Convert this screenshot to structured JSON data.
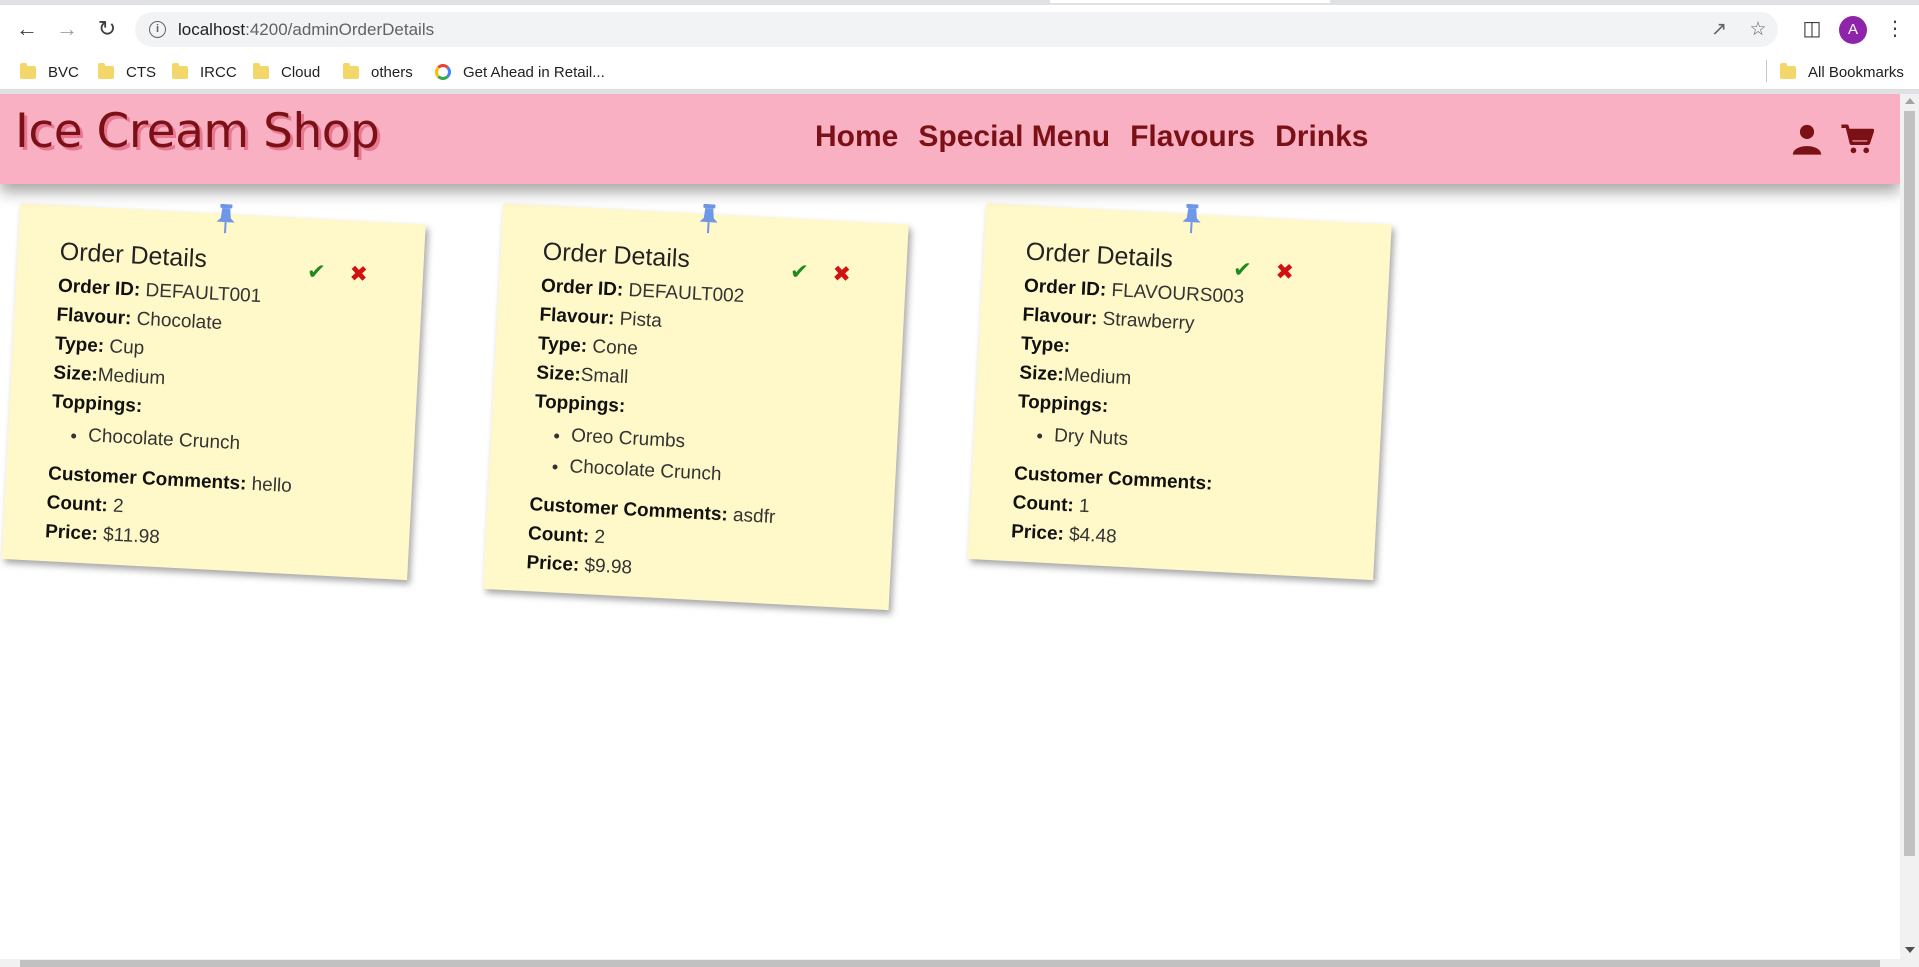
{
  "browser": {
    "url_host": "localhost",
    "url_path": ":4200/adminOrderDetails",
    "profile_initial": "A",
    "bookmarks": [
      {
        "label": "BVC",
        "icon": "folder-icon"
      },
      {
        "label": "CTS",
        "icon": "folder-icon"
      },
      {
        "label": "IRCC",
        "icon": "folder-icon"
      },
      {
        "label": "Cloud",
        "icon": "folder-icon"
      },
      {
        "label": "others",
        "icon": "folder-icon"
      },
      {
        "label": "Get Ahead in Retail...",
        "icon": "site-icon"
      }
    ],
    "all_bookmarks_label": "All Bookmarks"
  },
  "header": {
    "brand": "Ice Cream Shop",
    "nav": [
      "Home",
      "Special Menu",
      "Flavours",
      "Drinks"
    ],
    "icons": [
      "user-icon",
      "cart-icon"
    ],
    "colors": {
      "bg": "#f9b0c3",
      "text": "#7b1116"
    }
  },
  "labels": {
    "card_title": "Order Details",
    "order_id": "Order ID:",
    "flavour": "Flavour:",
    "type": "Type:",
    "size": "Size:",
    "toppings": "Toppings:",
    "comments": "Customer Comments:",
    "count": "Count:",
    "price": "Price:"
  },
  "orders": [
    {
      "order_id": "DEFAULT001",
      "flavour": "Chocolate",
      "type": "Cup",
      "size": "Medium",
      "toppings": [
        "Chocolate Crunch"
      ],
      "comments": "hello",
      "count": "2",
      "price": "$11.98"
    },
    {
      "order_id": "DEFAULT002",
      "flavour": "Pista",
      "type": "Cone",
      "size": "Small",
      "toppings": [
        "Oreo Crumbs",
        "Chocolate Crunch"
      ],
      "comments": "asdfr",
      "count": "2",
      "price": "$9.98"
    },
    {
      "order_id": "FLAVOURS003",
      "flavour": "Strawberry",
      "type": "",
      "size": "Medium",
      "toppings": [
        "Dry Nuts"
      ],
      "comments": "",
      "count": "1",
      "price": "$4.48"
    }
  ],
  "colors": {
    "card": "#fff8c9",
    "pin": "#6f97e8",
    "accept": "#1f8a1f",
    "reject": "#d21212"
  }
}
